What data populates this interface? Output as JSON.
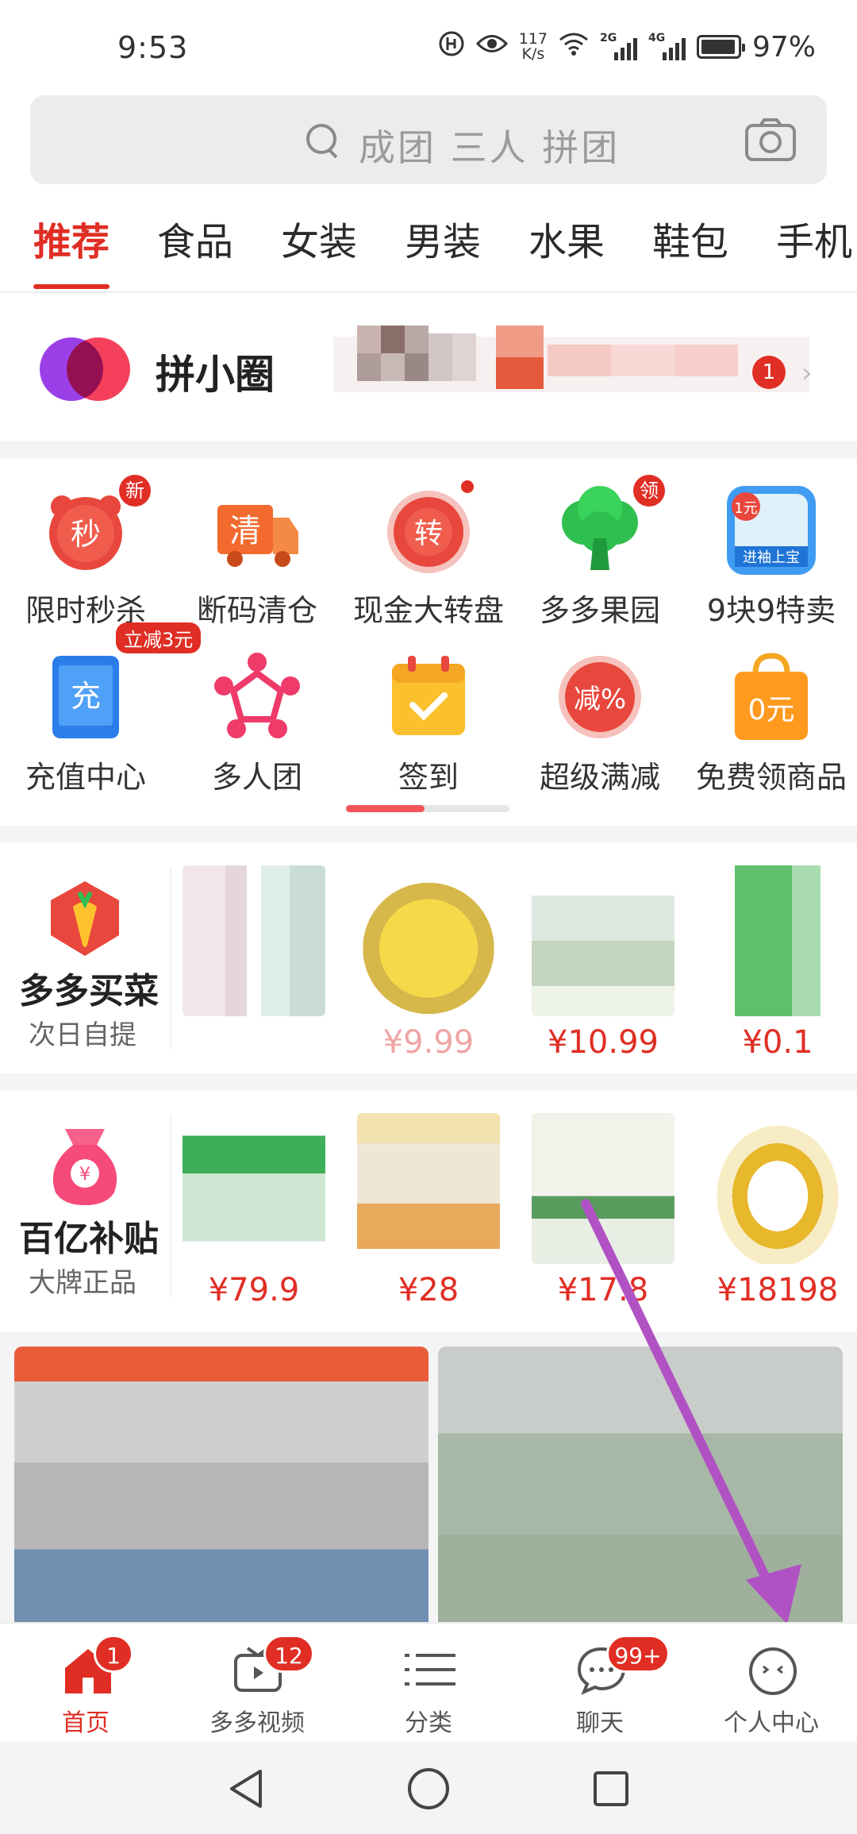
{
  "status_bar": {
    "time": "9:53",
    "net_speed_value": "117",
    "net_speed_unit": "K/s",
    "signal_1": "2G",
    "signal_2": "4G",
    "battery": "97%"
  },
  "search": {
    "placeholder": "成团 三人 拼团"
  },
  "tabs": [
    "推荐",
    "食品",
    "女装",
    "男装",
    "水果",
    "鞋包",
    "手机"
  ],
  "pin_circle": {
    "title": "拼小圈",
    "badge": "1"
  },
  "quick_entries": [
    {
      "label": "限时秒杀",
      "icon": "flash-sale-icon",
      "glyph": "秒",
      "tag": "新"
    },
    {
      "label": "断码清仓",
      "icon": "clearance-truck-icon",
      "glyph": "清"
    },
    {
      "label": "现金大转盘",
      "icon": "wheel-icon",
      "glyph": "转"
    },
    {
      "label": "多多果园",
      "icon": "tree-icon",
      "tag": "领"
    },
    {
      "label": "9块9特卖",
      "icon": "nine-nine-icon",
      "glyph": "1元",
      "subglyph": "进袖上宝"
    },
    {
      "label": "充值中心",
      "icon": "recharge-icon",
      "glyph": "充",
      "tag": "立减3元"
    },
    {
      "label": "多人团",
      "icon": "group-icon"
    },
    {
      "label": "签到",
      "icon": "calendar-check-icon"
    },
    {
      "label": "超级满减",
      "icon": "discount-icon",
      "glyph": "减%"
    },
    {
      "label": "免费领商品",
      "icon": "free-bag-icon",
      "glyph": "0元"
    }
  ],
  "quick_entries_scroll": 0.48,
  "duoduo_maicai": {
    "title": "多多买菜",
    "subtitle": "次日自提",
    "products": [
      {
        "price": "",
        "faded": true
      },
      {
        "price": "¥9.99",
        "faded": true
      },
      {
        "price": "¥10.99",
        "faded": false
      },
      {
        "price": "¥0.1",
        "faded": false
      }
    ]
  },
  "baiyi_butie": {
    "title": "百亿补贴",
    "subtitle": "大牌正品",
    "products": [
      {
        "price": "¥79.9"
      },
      {
        "price": "¥28"
      },
      {
        "price": "¥17.8"
      },
      {
        "price": "¥18198"
      }
    ]
  },
  "bottom_nav": [
    {
      "label": "首页",
      "icon": "home-icon",
      "badge": "1",
      "active": true
    },
    {
      "label": "多多视频",
      "icon": "video-icon",
      "badge": "12"
    },
    {
      "label": "分类",
      "icon": "category-icon"
    },
    {
      "label": "聊天",
      "icon": "chat-icon",
      "badge": "99+"
    },
    {
      "label": "个人中心",
      "icon": "profile-icon"
    }
  ],
  "colors": {
    "accent": "#e02e24",
    "annotation_arrow": "#b152c4"
  }
}
